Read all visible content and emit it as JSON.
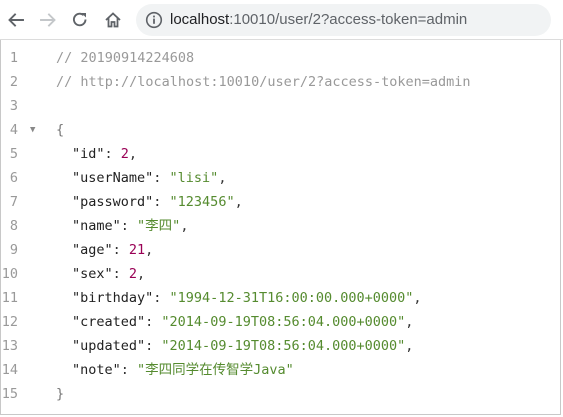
{
  "browser": {
    "url_host": "localhost",
    "url_rest": ":10010/user/2?access-token=admin"
  },
  "editor": {
    "line_numbers": [
      "1",
      "2",
      "3",
      "4",
      "5",
      "6",
      "7",
      "8",
      "9",
      "10",
      "11",
      "12",
      "13",
      "14",
      "15"
    ],
    "comment_1": "// 20190914224608",
    "comment_2": "// http://localhost:10010/user/2?access-token=admin",
    "open_brace": "{",
    "close_brace": "}",
    "fields": [
      {
        "key": "\"id\"",
        "value": "2",
        "type": "number"
      },
      {
        "key": "\"userName\"",
        "value": "\"lisi\"",
        "type": "string"
      },
      {
        "key": "\"password\"",
        "value": "\"123456\"",
        "type": "string"
      },
      {
        "key": "\"name\"",
        "value": "\"李四\"",
        "type": "string"
      },
      {
        "key": "\"age\"",
        "value": "21",
        "type": "number"
      },
      {
        "key": "\"sex\"",
        "value": "2",
        "type": "number"
      },
      {
        "key": "\"birthday\"",
        "value": "\"1994-12-31T16:00:00.000+0000\"",
        "type": "string"
      },
      {
        "key": "\"created\"",
        "value": "\"2014-09-19T08:56:04.000+0000\"",
        "type": "string"
      },
      {
        "key": "\"updated\"",
        "value": "\"2014-09-19T08:56:04.000+0000\"",
        "type": "string"
      },
      {
        "key": "\"note\"",
        "value": "\"李四同学在传智学Java\"",
        "type": "string"
      }
    ],
    "colors": {
      "number": "#990055",
      "string": "#558b2f",
      "comment": "#999999"
    }
  }
}
